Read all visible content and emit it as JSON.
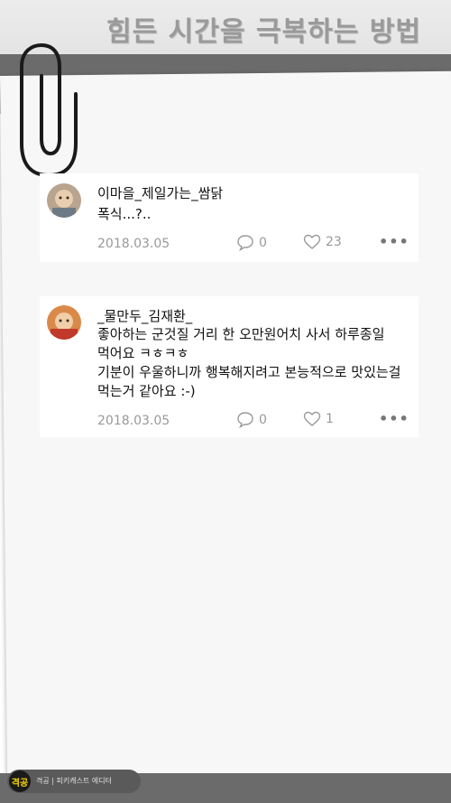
{
  "header": {
    "title": "힘든 시간을 극복하는 방법"
  },
  "comments": [
    {
      "nickname": "이마을_제일가는_쌈닭",
      "lines": [
        "폭식...?.."
      ],
      "date": "2018.03.05",
      "reply_count": "0",
      "like_count": "23"
    },
    {
      "nickname": "_물만두_김재환_",
      "lines": [
        "좋아하는 군것질 거리 한 오만원어치 사서 하루종일",
        "먹어요 ㅋㅎㅋㅎ",
        "기분이 우울하니까 행복해지려고 본능적으로 맛있는걸",
        "먹는거 같아요 :-)"
      ],
      "date": "2018.03.05",
      "reply_count": "0",
      "like_count": "1"
    }
  ],
  "footer": {
    "logo_text": "격공",
    "caption": "격공 | 피키캐스트 에디터"
  },
  "icons": {
    "reply": "speech-bubble-icon",
    "like": "heart-icon",
    "more": "more-dots-icon",
    "clip": "paperclip-icon"
  },
  "colors": {
    "band": "#6b6b6b",
    "meta": "#999999",
    "logo_accent": "#f5d400"
  }
}
